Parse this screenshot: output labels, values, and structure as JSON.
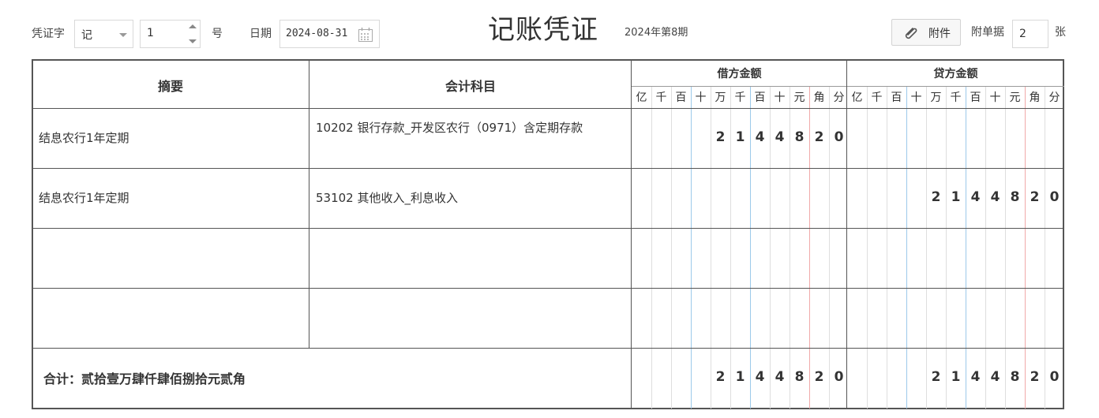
{
  "header": {
    "voucher_word_label": "凭证字",
    "voucher_word_value": "记",
    "voucher_number_value": "1",
    "number_suffix": "号",
    "date_label": "日期",
    "date_value": "2024-08-31",
    "title": "记账凭证",
    "period": "2024年第8期",
    "attachment_button": "附件",
    "attachment_doc_label": "附单据",
    "attachment_doc_count": "2",
    "attachment_doc_unit": "张"
  },
  "table": {
    "col_summary": "摘要",
    "col_account": "会计科目",
    "col_debit": "借方金额",
    "col_credit": "贷方金额",
    "units": [
      "亿",
      "千",
      "百",
      "十",
      "万",
      "千",
      "百",
      "十",
      "元",
      "角",
      "分"
    ],
    "rows": [
      {
        "summary": "结息农行1年定期",
        "account": "10202 银行存款_开发区农行（0971）含定期存款",
        "debit": "2144820",
        "credit": ""
      },
      {
        "summary": "结息农行1年定期",
        "account": "53102 其他收入_利息收入",
        "debit": "",
        "credit": "2144820"
      },
      {
        "summary": "",
        "account": "",
        "debit": "",
        "credit": ""
      },
      {
        "summary": "",
        "account": "",
        "debit": "",
        "credit": ""
      }
    ],
    "total_label": "合计：贰拾壹万肆仟肆佰捌拾元贰角",
    "total_debit": "2144820",
    "total_credit": "2144820"
  }
}
